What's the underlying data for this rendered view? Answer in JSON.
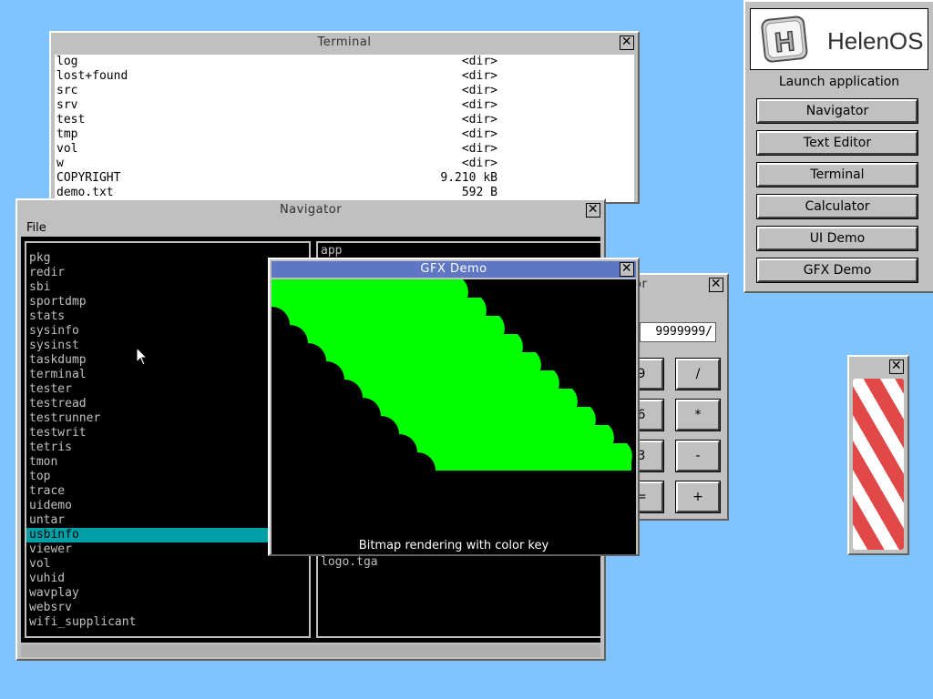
{
  "terminal": {
    "title": "Terminal",
    "rows": [
      {
        "name": "log",
        "size": "<dir>"
      },
      {
        "name": "lost+found",
        "size": "<dir>"
      },
      {
        "name": "src",
        "size": "<dir>"
      },
      {
        "name": "srv",
        "size": "<dir>"
      },
      {
        "name": "test",
        "size": "<dir>"
      },
      {
        "name": "tmp",
        "size": "<dir>"
      },
      {
        "name": "vol",
        "size": "<dir>"
      },
      {
        "name": "w",
        "size": "<dir>"
      },
      {
        "name": "COPYRIGHT",
        "size": "9.210 kB"
      },
      {
        "name": "demo.txt",
        "size": "592  B"
      }
    ]
  },
  "navigator": {
    "title": "Navigator",
    "menu_file": "File",
    "left_panel": [
      "pkg",
      "redir",
      "sbi",
      "sportdmp",
      "stats",
      "sysinfo",
      "sysinst",
      "taskdump",
      "terminal",
      "tester",
      "testread",
      "testrunner",
      "testwrit",
      "tetris",
      "tmon",
      "top",
      "trace",
      "uidemo",
      "untar",
      "usbinfo",
      "viewer",
      "vol",
      "vuhid",
      "wavplay",
      "websrv",
      "wifi_supplicant"
    ],
    "left_selected_index": 19,
    "right_panel_top": "app",
    "right_panel_visible_bottom": "logo.tga"
  },
  "calculator": {
    "title_fragment": "or",
    "display": "9999999/",
    "buttons": [
      "9",
      "/",
      "6",
      "*",
      "3",
      "-",
      "=",
      "+"
    ]
  },
  "gfx_demo": {
    "title": "GFX Demo",
    "caption": "Bitmap rendering with color key",
    "accent_color": "#00ff00"
  },
  "launcher": {
    "logo_text": "HelenOS",
    "logo_letter": "H",
    "title": "Launch application",
    "buttons": [
      "Navigator",
      "Text Editor",
      "Terminal",
      "Calculator",
      "UI Demo",
      "GFX Demo"
    ]
  },
  "close_glyph": "✕",
  "colors": {
    "desktop": "#80c4ff",
    "active_title": "#5e76c4",
    "selection": "#00a0a8",
    "barber_red": "#e14848"
  }
}
